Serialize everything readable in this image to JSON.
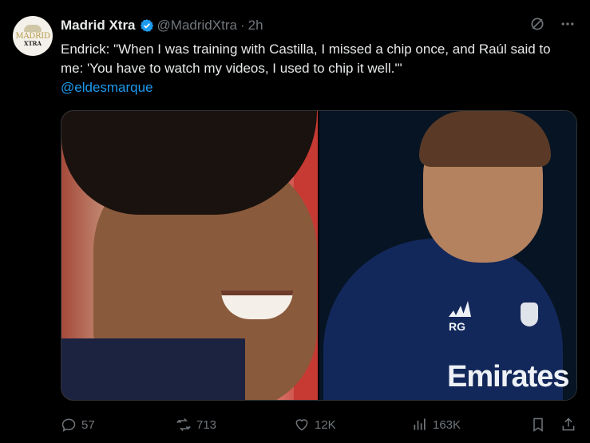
{
  "tweet": {
    "avatar": {
      "line1": "MADRID",
      "line2": "XTRA"
    },
    "display_name": "Madrid Xtra",
    "handle": "@MadridXtra",
    "separator": "·",
    "time": "2h",
    "text": "Endrick: \"When I was training with Castilla, I missed a chip once, and Raúl said to me: 'You have to watch my videos, I used to chip it well.'\"",
    "mention": "@eldesmarque",
    "media": {
      "right_initials": "RG",
      "right_sponsor": "Emirates"
    },
    "actions": {
      "replies": "57",
      "reposts": "713",
      "likes": "12K",
      "views": "163K"
    }
  },
  "colors": {
    "background": "#000000",
    "text": "#e7e9ea",
    "muted": "#71767b",
    "link": "#1d9bf0",
    "verified": "#1d9bf0"
  },
  "icons": [
    "verified-badge-icon",
    "grok-icon",
    "more-icon",
    "reply-icon",
    "repost-icon",
    "like-icon",
    "views-icon",
    "bookmark-icon",
    "share-icon"
  ]
}
